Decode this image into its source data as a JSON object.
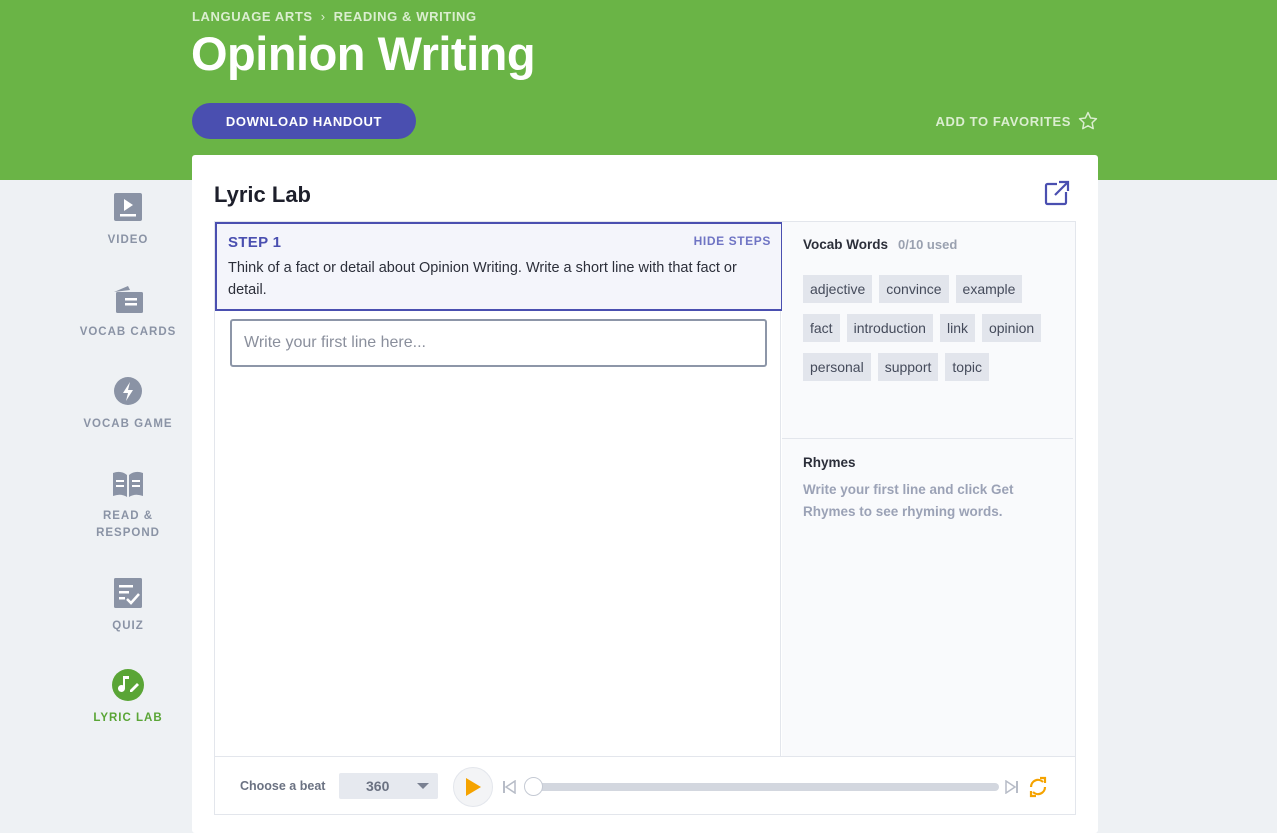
{
  "breadcrumb": {
    "parent": "LANGUAGE ARTS",
    "separator": "›",
    "current": "READING & WRITING"
  },
  "page": {
    "title": "Opinion Writing"
  },
  "actions": {
    "download_label": "DOWNLOAD HANDOUT",
    "favorite_label": "ADD TO FAVORITES"
  },
  "sidebar": {
    "items": [
      {
        "label": "VIDEO",
        "icon": "video-icon"
      },
      {
        "label": "VOCAB CARDS",
        "icon": "vocab-cards-icon"
      },
      {
        "label": "VOCAB GAME",
        "icon": "lightning-icon"
      },
      {
        "label": "READ & RESPOND",
        "icon": "book-icon"
      },
      {
        "label": "QUIZ",
        "icon": "quiz-icon"
      },
      {
        "label": "LYRIC LAB",
        "icon": "music-pen-icon",
        "active": true
      }
    ]
  },
  "lyric_lab": {
    "title": "Lyric Lab",
    "step": {
      "label": "STEP 1",
      "hide_label": "HIDE STEPS",
      "instruction": "Think of a fact or detail about Opinion Writing. Write a short line with that fact or detail."
    },
    "input": {
      "placeholder": "Write your first line here...",
      "value": ""
    },
    "vocab": {
      "heading": "Vocab Words",
      "count": "0/10 used",
      "words": [
        "adjective",
        "convince",
        "example",
        "fact",
        "introduction",
        "link",
        "opinion",
        "personal",
        "support",
        "topic"
      ]
    },
    "rhymes": {
      "heading": "Rhymes",
      "hint": "Write your first line and click Get Rhymes to see rhyming words."
    },
    "beat": {
      "label": "Choose a beat",
      "selected": "360",
      "progress": 0
    }
  },
  "colors": {
    "brand_green": "#6ab446",
    "accent_indigo": "#4a4fb0",
    "play_orange": "#f5a300"
  }
}
